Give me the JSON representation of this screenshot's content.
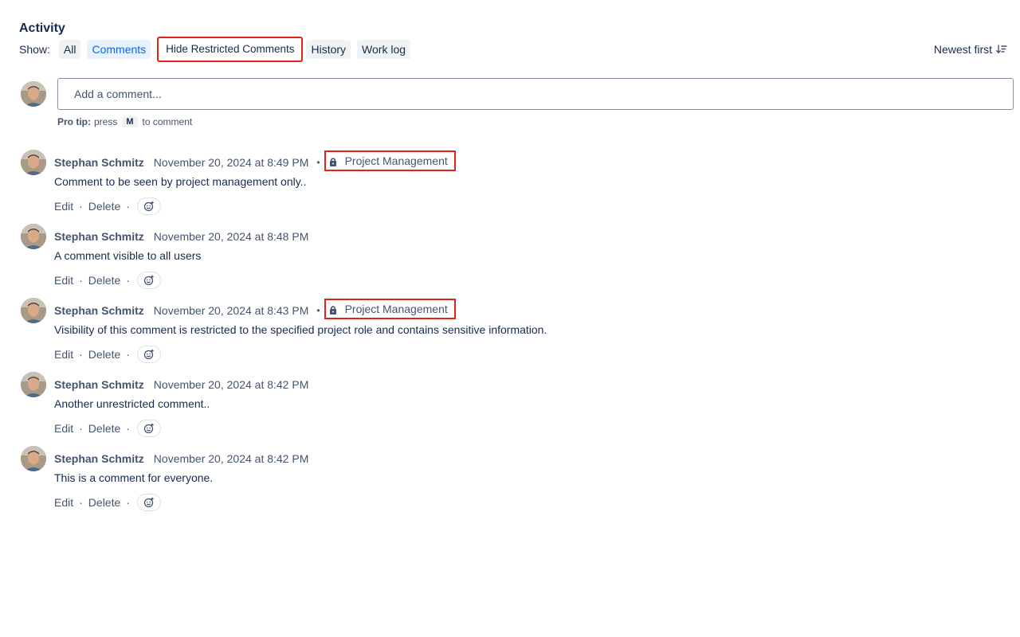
{
  "activity": {
    "title": "Activity",
    "show_label": "Show:",
    "filters": [
      {
        "label": "All",
        "state": "default"
      },
      {
        "label": "Comments",
        "state": "selected"
      },
      {
        "label": "Hide Restricted Comments",
        "state": "highlighted"
      },
      {
        "label": "History",
        "state": "default"
      },
      {
        "label": "Work log",
        "state": "default"
      }
    ],
    "sort": {
      "label": "Newest first",
      "icon": "sort-descending-icon"
    }
  },
  "composer": {
    "placeholder": "Add a comment...",
    "protip": {
      "lead": "Pro tip:",
      "press": "press",
      "key": "M",
      "suffix": "to comment"
    }
  },
  "comments": [
    {
      "author": "Stephan Schmitz",
      "timestamp": "November 20, 2024 at 8:49 PM",
      "restricted": true,
      "restriction_label": "Project Management",
      "body": "Comment to be seen by project management only..",
      "actions": {
        "edit": "Edit",
        "delete": "Delete"
      }
    },
    {
      "author": "Stephan Schmitz",
      "timestamp": "November 20, 2024 at 8:48 PM",
      "restricted": false,
      "body": "A comment visible to all users",
      "actions": {
        "edit": "Edit",
        "delete": "Delete"
      }
    },
    {
      "author": "Stephan Schmitz",
      "timestamp": "November 20, 2024 at 8:43 PM",
      "restricted": true,
      "restriction_label": "Project Management",
      "body": "Visibility of this comment is restricted to the specified project role and contains sensitive information.",
      "actions": {
        "edit": "Edit",
        "delete": "Delete"
      }
    },
    {
      "author": "Stephan Schmitz",
      "timestamp": "November 20, 2024 at 8:42 PM",
      "restricted": false,
      "body": "Another unrestricted comment..",
      "actions": {
        "edit": "Edit",
        "delete": "Delete"
      }
    },
    {
      "author": "Stephan Schmitz",
      "timestamp": "November 20, 2024 at 8:42 PM",
      "restricted": false,
      "body": "This is a comment for everyone.",
      "actions": {
        "edit": "Edit",
        "delete": "Delete"
      }
    }
  ],
  "colors": {
    "highlight_border": "#e2231a",
    "selected_filter_text": "#0c66e4",
    "selected_filter_bg": "#e9f2ff"
  }
}
